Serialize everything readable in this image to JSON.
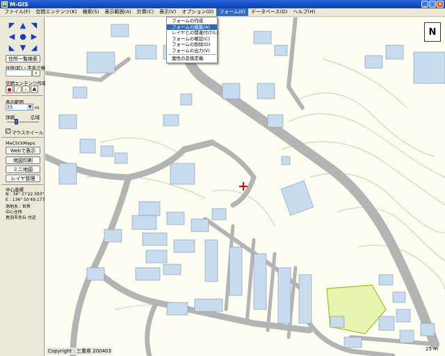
{
  "window": {
    "title": "M-GIS"
  },
  "menu": {
    "items": [
      {
        "label": "ファイル(F)"
      },
      {
        "label": "空間エンテンツ(K)"
      },
      {
        "label": "検索(S)"
      },
      {
        "label": "表示範囲(A)"
      },
      {
        "label": "計算(C)"
      },
      {
        "label": "表示(V)"
      },
      {
        "label": "オプション(O)"
      },
      {
        "label": "フォーム(E)"
      },
      {
        "label": "データベース(D)"
      },
      {
        "label": "ヘルプ(H)"
      }
    ],
    "open_index": 7
  },
  "form_menu": {
    "items": [
      {
        "label": "フォームの作成"
      },
      {
        "label": "フォームの編集(A)",
        "highlighted": true
      },
      {
        "label": "レイヤとの関連付け(L)"
      },
      {
        "label": "フォームの確認(C)"
      },
      {
        "label": "フォームの削除(D)"
      },
      {
        "label": "フォームの出力(V)"
      },
      {
        "label": "属性の変換定義",
        "separator_before": true
      }
    ]
  },
  "left_panel": {
    "address_list_button": "住所一覧検索",
    "search_label": "住所(町)・字名で検索",
    "search_value": "",
    "spatial_label": "空間エンテンツ作成",
    "tool_icons": [
      "pin-icon",
      "line-icon",
      "polygon-icon",
      "text-icon"
    ],
    "tool_text": "A",
    "range_label": "表示範囲",
    "scale_value": "25",
    "scale_unit": "m",
    "detail_label": "詳細",
    "wide_label": "広域",
    "slider_position": 0.3,
    "mouse_wheel_label": "マウスホイール",
    "mouse_wheel_checked": true,
    "maps_label": "MeClickMaps",
    "web_button": "Webで表示",
    "print_button": "地図印刷",
    "mini_button": "ミニ地図",
    "layer_button": "レイヤ管理",
    "center_label": "中心座標",
    "lat": "N : 34° 2?'22.393\"",
    "lon": "E : 136° 50'49.177\"",
    "datum": "測地系 : 世界",
    "center_address_label": "中心住所",
    "center_address": "鳥羽市幸丘 付近"
  },
  "map": {
    "copyright": "Copyright : 三重県 200403",
    "scale_text": "25 m",
    "compass_label": "N",
    "colors": {
      "background": "#fdfdf2",
      "road": "#b4b4b4",
      "building": "#c8dcef",
      "contour": "#90d490",
      "park": "#e8f5b0"
    }
  }
}
